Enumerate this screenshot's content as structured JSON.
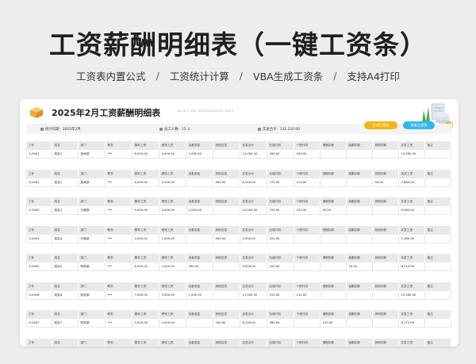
{
  "headline": "工资薪酬明细表（一键工资条）",
  "features": [
    "工资表内置公式",
    "工资统计计算",
    "VBA生成工资条",
    "支持A4打印"
  ],
  "features_sep": "/",
  "sheet": {
    "title": "2025年2月工资薪酬明细表",
    "title_en": "SALARY AND REMUNERATION TABLE",
    "info": {
      "period_label": "统计日期:",
      "period_value": "2025年2月",
      "staff_label": "员工人数:",
      "staff_value": "15 人",
      "total_label": "实发合计:",
      "total_value": "131,220.00"
    },
    "buttons": {
      "generate": "生成工资条",
      "restore": "恢复工资表"
    },
    "columns": [
      "工号",
      "姓名",
      "部门",
      "职务",
      "基本工资",
      "绩效工资",
      "出差奖金",
      "其他应发",
      "应发合计",
      "社保代扣",
      "个税代扣",
      "请假扣款",
      "缺勤扣款",
      "其他扣款",
      "实发工资",
      "备注"
    ],
    "rows": [
      [
        "S-0001",
        "姓名1",
        "技术部",
        "***",
        "8,000.00",
        "4,000.00",
        "2,000.00",
        "",
        "14,000.00",
        "260.00",
        "150.00",
        "",
        "",
        "",
        "13,590.00",
        ""
      ],
      [
        "S-0002",
        "姓名2",
        "技术部",
        "***",
        "6,000.00",
        "2,000.00",
        "",
        "500.00",
        "8,500.00",
        "270.00",
        "120.00",
        "",
        "",
        "50.00",
        "7,860.00",
        ""
      ],
      [
        "S-0003",
        "姓名3",
        "行政部",
        "***",
        "5,000.00",
        "4,000.00",
        "1,000.00",
        "",
        "10,000.00",
        "370.00",
        "100.00",
        "50.00",
        "",
        "",
        "9,480.00",
        ""
      ],
      [
        "S-0004",
        "姓名4",
        "行政部",
        "***",
        "4,000.00",
        "1,000.00",
        "",
        "500.00",
        "5,500.00",
        "320.00",
        "",
        "",
        "",
        "",
        "5,180.00",
        ""
      ],
      [
        "S-0005",
        "姓名5",
        "财务部",
        "***",
        "6,500.00",
        "2,000.00",
        "500.00",
        "",
        "9,000.00",
        "310.00",
        "",
        "",
        "30.00",
        "",
        "8,710.00",
        ""
      ],
      [
        "S-0006",
        "姓名6",
        "财务部",
        "***",
        "7,000.00",
        "3,000.00",
        "1,000.00",
        "",
        "11,000.00",
        "310.00",
        "110.00",
        "",
        "",
        "",
        "10,580.00",
        ""
      ],
      [
        "S-0007",
        "姓名7",
        "财务部",
        "***",
        "4,500.00",
        "4,000.00",
        "",
        "200.00",
        "8,700.00",
        "380.00",
        "",
        "150.00",
        "",
        "",
        "8,170.00",
        ""
      ]
    ],
    "last_header_only": true
  },
  "colors": {
    "accent_yellow": "#f7b315",
    "accent_blue": "#35b5ee",
    "header_gray": "#e9e9e9"
  }
}
